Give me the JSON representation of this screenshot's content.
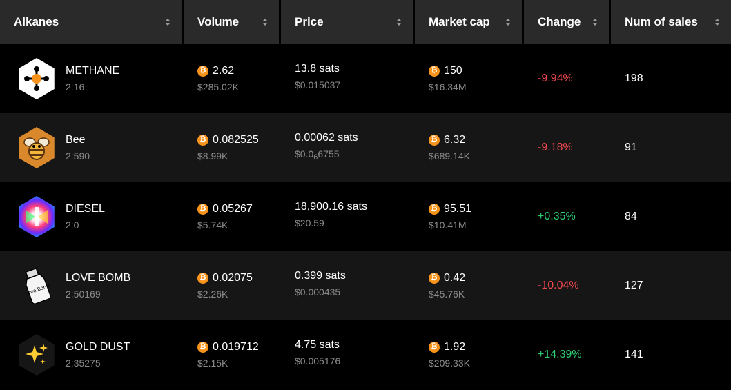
{
  "headers": [
    {
      "label": "Alkanes"
    },
    {
      "label": "Volume"
    },
    {
      "label": "Price"
    },
    {
      "label": "Market cap"
    },
    {
      "label": "Change"
    },
    {
      "label": "Num of sales"
    }
  ],
  "btc_symbol": "₿",
  "rows": [
    {
      "name": "METHANE",
      "id": "2:16",
      "logo_icon": "methane-molecule-icon",
      "volume": "2.62",
      "volume_usd": "$285.02K",
      "price": "13.8 sats",
      "price_usd": "$0.015037",
      "price_usd_sub": "",
      "price_usd_tail": "",
      "mcap": "150",
      "mcap_usd": "$16.34M",
      "change": "-9.94%",
      "change_dir": "neg",
      "sales": "198"
    },
    {
      "name": "Bee",
      "id": "2:590",
      "logo_icon": "bee-icon",
      "volume": "0.082525",
      "volume_usd": "$8.99K",
      "price": "0.00062 sats",
      "price_usd": "$0.0",
      "price_usd_sub": "6",
      "price_usd_tail": "6755",
      "mcap": "6.32",
      "mcap_usd": "$689.14K",
      "change": "-9.18%",
      "change_dir": "neg",
      "sales": "91"
    },
    {
      "name": "DIESEL",
      "id": "2:0",
      "logo_icon": "diesel-prism-icon",
      "volume": "0.05267",
      "volume_usd": "$5.74K",
      "price": "18,900.16 sats",
      "price_usd": "$20.59",
      "price_usd_sub": "",
      "price_usd_tail": "",
      "mcap": "95.51",
      "mcap_usd": "$10.41M",
      "change": "+0.35%",
      "change_dir": "pos",
      "sales": "84"
    },
    {
      "name": "LOVE BOMB",
      "id": "2:50169",
      "logo_icon": "love-bomb-icon",
      "logo_text": "Love Bomb",
      "volume": "0.02075",
      "volume_usd": "$2.26K",
      "price": "0.399 sats",
      "price_usd": "$0.000435",
      "price_usd_sub": "",
      "price_usd_tail": "",
      "mcap": "0.42",
      "mcap_usd": "$45.76K",
      "change": "-10.04%",
      "change_dir": "neg",
      "sales": "127"
    },
    {
      "name": "GOLD DUST",
      "id": "2:35275",
      "logo_icon": "sparkles-icon",
      "volume": "0.019712",
      "volume_usd": "$2.15K",
      "price": "4.75 sats",
      "price_usd": "$0.005176",
      "price_usd_sub": "",
      "price_usd_tail": "",
      "mcap": "1.92",
      "mcap_usd": "$209.33K",
      "change": "+14.39%",
      "change_dir": "pos",
      "sales": "141"
    }
  ],
  "colors": {
    "negative": "#f0484f",
    "positive": "#2ecc71",
    "btc": "#f7931a",
    "header_bg": "#2a2a2a"
  }
}
